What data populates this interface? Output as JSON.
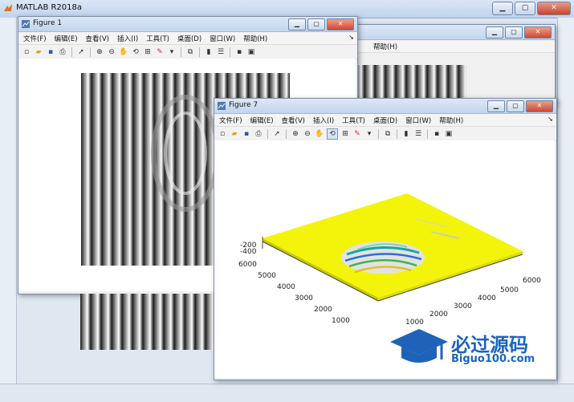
{
  "app": {
    "title": "MATLAB R2018a"
  },
  "fig1": {
    "title": "Figure 1"
  },
  "fig7": {
    "title": "Figure 7"
  },
  "menu": [
    "文件(F)",
    "编辑(E)",
    "查看(V)",
    "插入(I)",
    "工具(T)",
    "桌面(D)",
    "窗口(W)",
    "帮助(H)"
  ],
  "back_menu": {
    "item": "帮助(H)"
  },
  "z_ticks": [
    "-200",
    "-400"
  ],
  "y_ticks": [
    "6000",
    "5000",
    "4000",
    "3000",
    "2000",
    "1000"
  ],
  "x_ticks": [
    "6000",
    "5000",
    "4000",
    "3000",
    "2000",
    "1000"
  ],
  "colors": {
    "surface": "#f4f40a",
    "titlebar": "#c2d5ec"
  },
  "watermark": {
    "name": "必过源码",
    "url": "Biguo100.com"
  }
}
